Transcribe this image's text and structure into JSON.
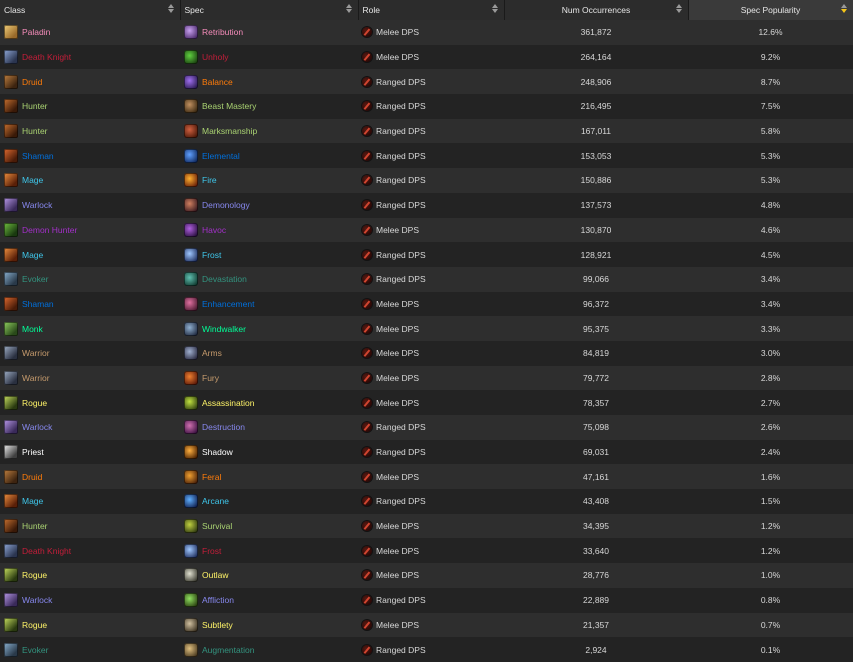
{
  "headers": {
    "class": "Class",
    "spec": "Spec",
    "role": "Role",
    "num": "Num Occurrences",
    "pop": "Spec Popularity"
  },
  "class_colors": {
    "Paladin": "#f58cba",
    "Death Knight": "#c41e3a",
    "Druid": "#ff7c0a",
    "Hunter": "#aad372",
    "Shaman": "#0070dd",
    "Mage": "#3fc7eb",
    "Warlock": "#8788ee",
    "Demon Hunter": "#a330c9",
    "Evoker": "#33937f",
    "Monk": "#00ff98",
    "Warrior": "#c69b6d",
    "Rogue": "#fff468",
    "Priest": "#ffffff"
  },
  "rows": [
    {
      "class": "Paladin",
      "spec": "Retribution",
      "role": "Melee DPS",
      "num": "361,872",
      "pop": "12.6%"
    },
    {
      "class": "Death Knight",
      "spec": "Unholy",
      "role": "Melee DPS",
      "num": "264,164",
      "pop": "9.2%"
    },
    {
      "class": "Druid",
      "spec": "Balance",
      "role": "Ranged DPS",
      "num": "248,906",
      "pop": "8.7%"
    },
    {
      "class": "Hunter",
      "spec": "Beast Mastery",
      "role": "Ranged DPS",
      "num": "216,495",
      "pop": "7.5%"
    },
    {
      "class": "Hunter",
      "spec": "Marksmanship",
      "role": "Ranged DPS",
      "num": "167,011",
      "pop": "5.8%"
    },
    {
      "class": "Shaman",
      "spec": "Elemental",
      "role": "Ranged DPS",
      "num": "153,053",
      "pop": "5.3%"
    },
    {
      "class": "Mage",
      "spec": "Fire",
      "role": "Ranged DPS",
      "num": "150,886",
      "pop": "5.3%"
    },
    {
      "class": "Warlock",
      "spec": "Demonology",
      "role": "Ranged DPS",
      "num": "137,573",
      "pop": "4.8%"
    },
    {
      "class": "Demon Hunter",
      "spec": "Havoc",
      "role": "Melee DPS",
      "num": "130,870",
      "pop": "4.6%"
    },
    {
      "class": "Mage",
      "spec": "Frost",
      "role": "Ranged DPS",
      "num": "128,921",
      "pop": "4.5%"
    },
    {
      "class": "Evoker",
      "spec": "Devastation",
      "role": "Ranged DPS",
      "num": "99,066",
      "pop": "3.4%"
    },
    {
      "class": "Shaman",
      "spec": "Enhancement",
      "role": "Melee DPS",
      "num": "96,372",
      "pop": "3.4%"
    },
    {
      "class": "Monk",
      "spec": "Windwalker",
      "role": "Melee DPS",
      "num": "95,375",
      "pop": "3.3%"
    },
    {
      "class": "Warrior",
      "spec": "Arms",
      "role": "Melee DPS",
      "num": "84,819",
      "pop": "3.0%"
    },
    {
      "class": "Warrior",
      "spec": "Fury",
      "role": "Melee DPS",
      "num": "79,772",
      "pop": "2.8%"
    },
    {
      "class": "Rogue",
      "spec": "Assassination",
      "role": "Melee DPS",
      "num": "78,357",
      "pop": "2.7%"
    },
    {
      "class": "Warlock",
      "spec": "Destruction",
      "role": "Ranged DPS",
      "num": "75,098",
      "pop": "2.6%"
    },
    {
      "class": "Priest",
      "spec": "Shadow",
      "role": "Ranged DPS",
      "num": "69,031",
      "pop": "2.4%"
    },
    {
      "class": "Druid",
      "spec": "Feral",
      "role": "Melee DPS",
      "num": "47,161",
      "pop": "1.6%"
    },
    {
      "class": "Mage",
      "spec": "Arcane",
      "role": "Ranged DPS",
      "num": "43,408",
      "pop": "1.5%"
    },
    {
      "class": "Hunter",
      "spec": "Survival",
      "role": "Melee DPS",
      "num": "34,395",
      "pop": "1.2%"
    },
    {
      "class": "Death Knight",
      "spec": "Frost",
      "role": "Melee DPS",
      "num": "33,640",
      "pop": "1.2%"
    },
    {
      "class": "Rogue",
      "spec": "Outlaw",
      "role": "Melee DPS",
      "num": "28,776",
      "pop": "1.0%"
    },
    {
      "class": "Warlock",
      "spec": "Affliction",
      "role": "Ranged DPS",
      "num": "22,889",
      "pop": "0.8%"
    },
    {
      "class": "Rogue",
      "spec": "Subtlety",
      "role": "Melee DPS",
      "num": "21,357",
      "pop": "0.7%"
    },
    {
      "class": "Evoker",
      "spec": "Augmentation",
      "role": "Ranged DPS",
      "num": "2,924",
      "pop": "0.1%"
    }
  ]
}
